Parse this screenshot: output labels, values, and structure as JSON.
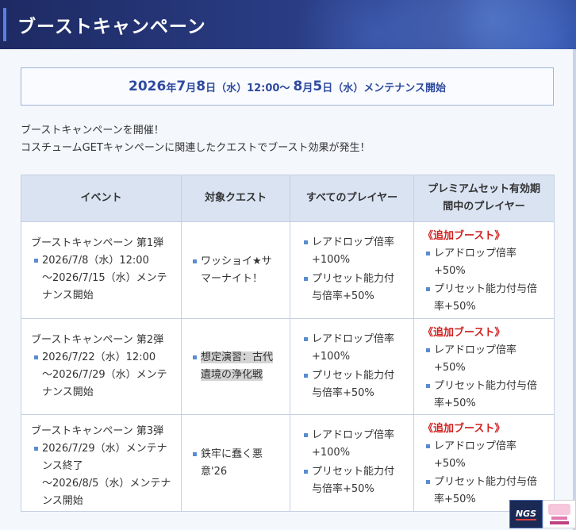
{
  "header": {
    "title": "ブーストキャンペーン"
  },
  "period": {
    "year": "2026",
    "year_unit": "年",
    "start_month": "7",
    "month_unit": "月",
    "start_day": "8",
    "day_unit": "日",
    "start_weekday": "（水）",
    "start_time": "12:00～",
    "end_month": "8",
    "end_month_unit": "月",
    "end_day": "5",
    "end_day_unit": "日",
    "end_weekday": "（水）",
    "end_text": "メンテナンス開始"
  },
  "description": {
    "line1": "ブーストキャンペーンを開催！",
    "line2": "コスチュームGETキャンペーンに関連したクエストでブースト効果が発生！"
  },
  "table": {
    "headers": {
      "event": "イベント",
      "quest": "対象クエスト",
      "all_players": "すべてのプレイヤー",
      "premium_line1": "プレミアムセット有効期",
      "premium_line2": "間中のプレイヤー"
    },
    "rows": [
      {
        "event_name": "ブーストキャンペーン 第1弾",
        "event_date_line1": "2026/7/8（水）12:00",
        "event_date_line2": "～2026/7/15（水）メンテ",
        "event_date_line3": "ナンス開始",
        "quest_line1": "ワッショイ★サ",
        "quest_line2": "マーナイト！",
        "all_item1_line1": "レアドロップ倍率",
        "all_item1_line2": "+100%",
        "all_item2_line1": "プリセット能力付",
        "all_item2_line2": "与倍率+50%",
        "prem_heading": "《追加ブースト》",
        "prem_item1_line1": "レアドロップ倍率",
        "prem_item1_line2": "+50%",
        "prem_item2_line1": "プリセット能力付与倍",
        "prem_item2_line2": "率+50%"
      },
      {
        "event_name": "ブーストキャンペーン 第2弾",
        "event_date_line1": "2026/7/22（水）12:00",
        "event_date_line2": "～2026/7/29（水）メンテ",
        "event_date_line3": "ナンス開始",
        "quest_line1": "想定演習：古代",
        "quest_line2": "遺境の浄化戦",
        "all_item1_line1": "レアドロップ倍率",
        "all_item1_line2": "+100%",
        "all_item2_line1": "プリセット能力付",
        "all_item2_line2": "与倍率+50%",
        "prem_heading": "《追加ブースト》",
        "prem_item1_line1": "レアドロップ倍率",
        "prem_item1_line2": "+50%",
        "prem_item2_line1": "プリセット能力付与倍",
        "prem_item2_line2": "率+50%"
      },
      {
        "event_name": "ブーストキャンペーン 第3弾",
        "event_date_line1": "2026/7/29（水）メンテナ",
        "event_date_line2": "ンス終了",
        "event_date_line3": "～2026/8/5（水）メンテナ",
        "event_date_line4": "ンス開始",
        "quest_line1": "鉄牢に蠢く悪",
        "quest_line2": "意'26",
        "all_item1_line1": "レアドロップ倍率",
        "all_item1_line2": "+100%",
        "all_item2_line1": "プリセット能力付",
        "all_item2_line2": "与倍率+50%",
        "prem_heading": "《追加ブースト》",
        "prem_item1_line1": "レアドロップ倍率",
        "prem_item1_line2": "+50%",
        "prem_item2_line1": "プリセット能力付与倍",
        "prem_item2_line2": "率+50%"
      }
    ]
  },
  "logos": {
    "ngs": "NGS"
  }
}
